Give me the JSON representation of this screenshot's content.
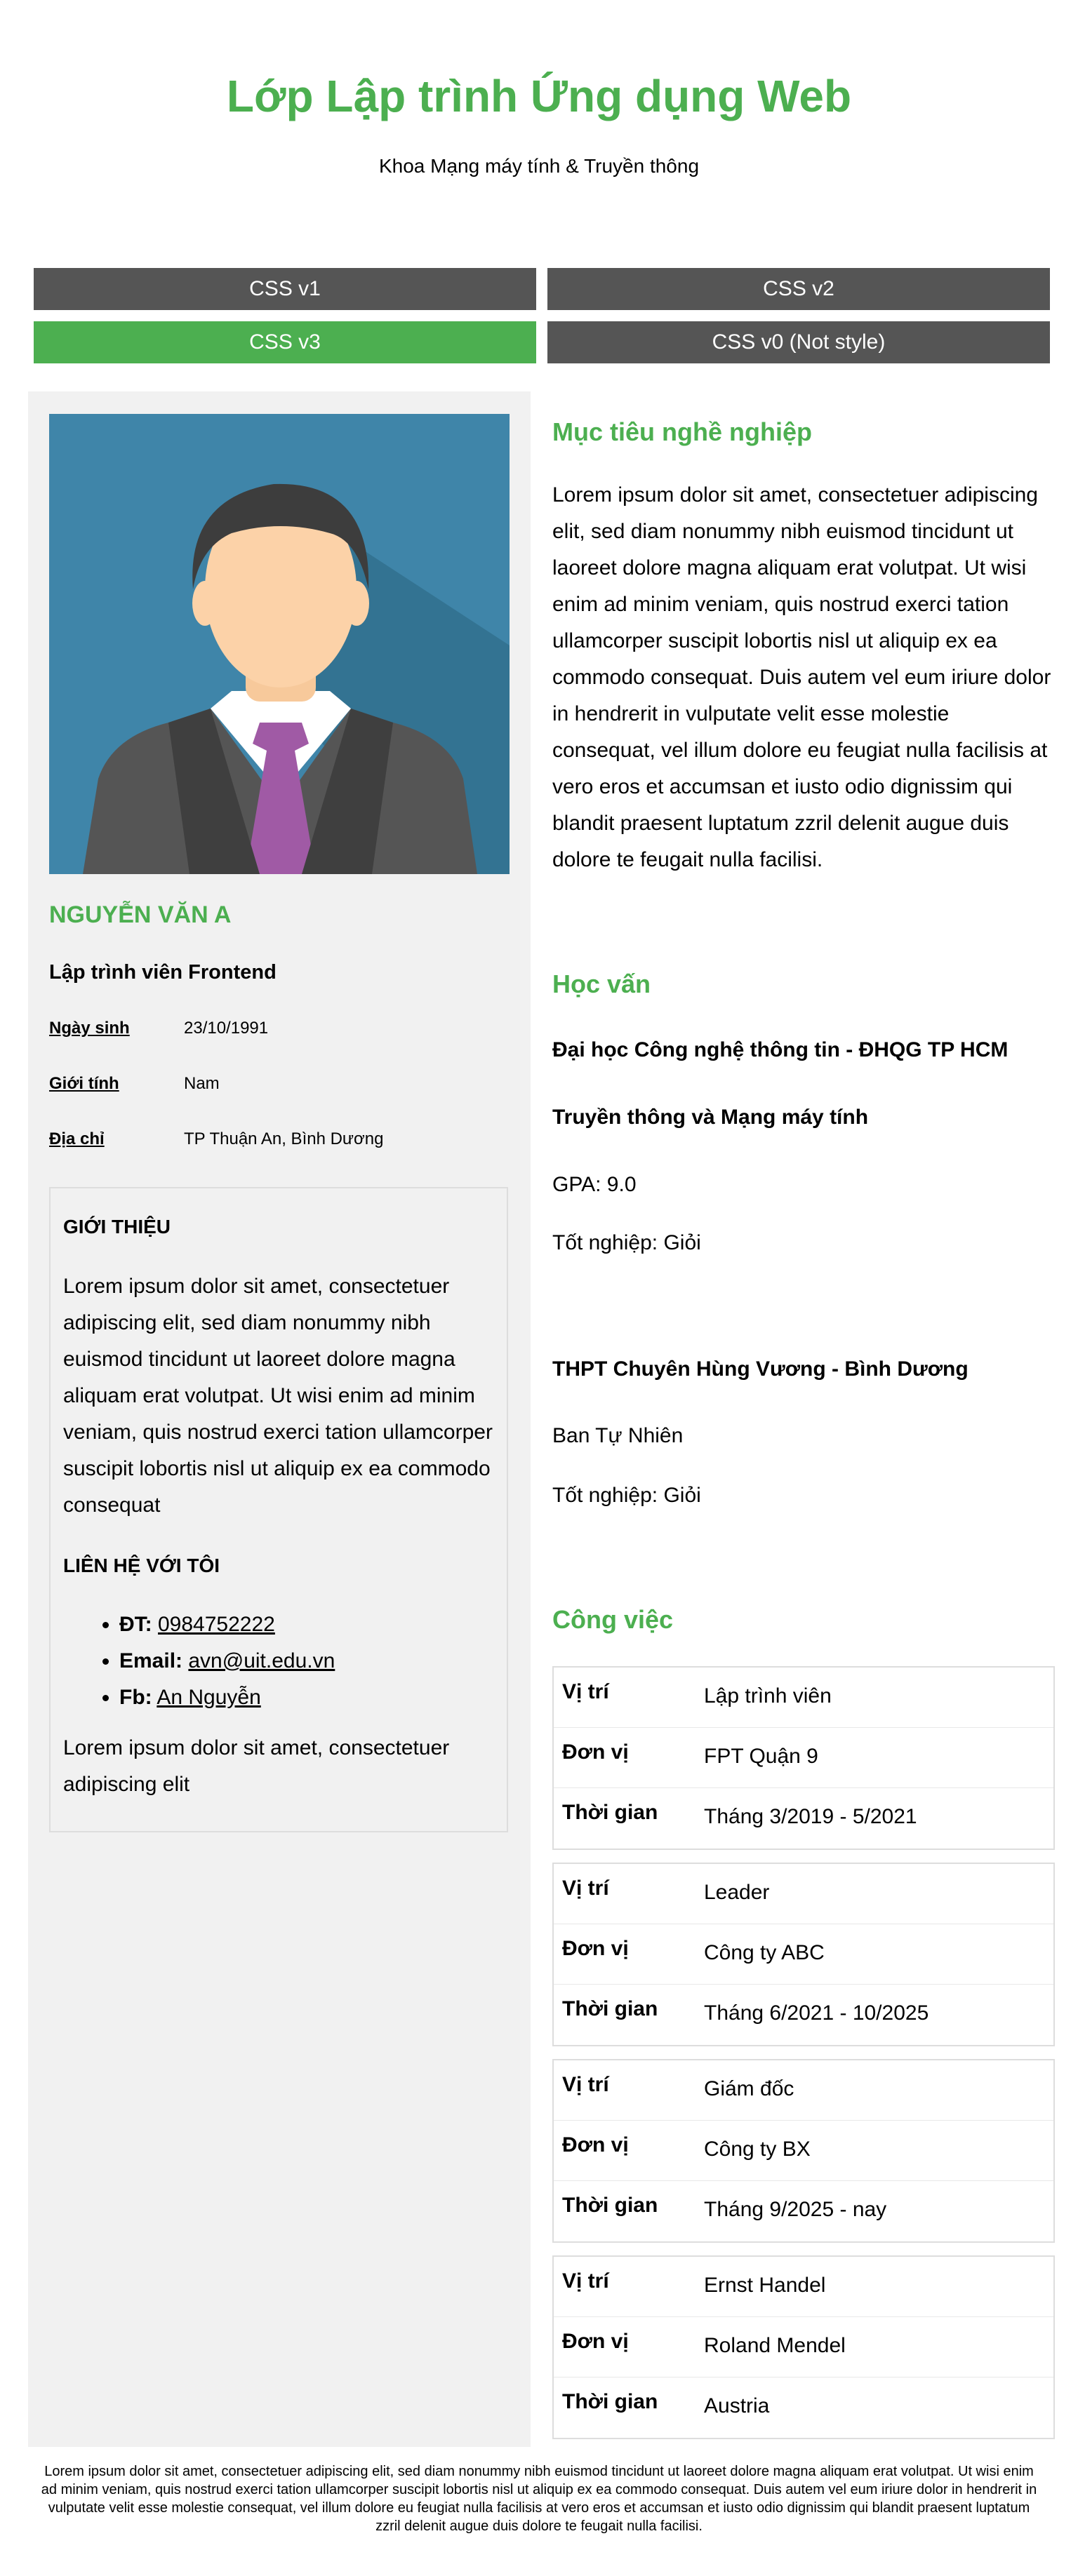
{
  "header": {
    "title": "Lớp Lập trình Ứng dụng Web",
    "subtitle": "Khoa Mạng máy tính & Truyền thông"
  },
  "nav": {
    "buttons": [
      {
        "label": "CSS v1",
        "active": false
      },
      {
        "label": "CSS v2",
        "active": false
      },
      {
        "label": "CSS v3",
        "active": true
      },
      {
        "label": "CSS v0 (Not style)",
        "active": false
      }
    ]
  },
  "profile": {
    "name": "NGUYỄN VĂN A",
    "role": "Lập trình viên Frontend",
    "info": [
      {
        "label": "Ngày sinh",
        "value": "23/10/1991"
      },
      {
        "label": "Giới tính",
        "value": "Nam"
      },
      {
        "label": "Địa chỉ",
        "value": "TP Thuận An, Bình Dương"
      }
    ],
    "intro_heading": "GIỚI THIỆU",
    "intro_text": "Lorem ipsum dolor sit amet, consectetuer adipiscing elit, sed diam nonummy nibh euismod tincidunt ut laoreet dolore magna aliquam erat volutpat. Ut wisi enim ad minim veniam, quis nostrud exerci tation ullamcorper suscipit lobortis nisl ut aliquip ex ea commodo consequat",
    "contact_heading": "LIÊN HỆ VỚI TÔI",
    "contacts": [
      {
        "label": "ĐT:",
        "value": "0984752222"
      },
      {
        "label": "Email:",
        "value": "avn@uit.edu.vn"
      },
      {
        "label": "Fb:",
        "value": "An Nguyễn"
      }
    ],
    "contact_note": "Lorem ipsum dolor sit amet, consectetuer adipiscing elit"
  },
  "career": {
    "title": "Mục tiêu nghề nghiệp",
    "text": "Lorem ipsum dolor sit amet, consectetuer adipiscing elit, sed diam nonummy nibh euismod tincidunt ut laoreet dolore magna aliquam erat volutpat. Ut wisi enim ad minim veniam, quis nostrud exerci tation ullamcorper suscipit lobortis nisl ut aliquip ex ea commodo consequat. Duis autem vel eum iriure dolor in hendrerit in vulputate velit esse molestie consequat, vel illum dolore eu feugiat nulla facilisis at vero eros et accumsan et iusto odio dignissim qui blandit praesent luptatum zzril delenit augue duis dolore te feugait nulla facilisi."
  },
  "education": {
    "title": "Học vấn",
    "university": "Đại học Công nghệ thông tin - ĐHQG TP HCM",
    "major": "Truyền thông và Mạng máy tính",
    "gpa": "GPA: 9.0",
    "uni_grad": "Tốt nghiệp: Giỏi",
    "school": "THPT Chuyên Hùng Vương - Bình Dương",
    "track": "Ban Tự Nhiên",
    "school_grad": "Tốt nghiệp: Giỏi"
  },
  "work": {
    "title": "Công việc",
    "labels": {
      "position": "Vị trí",
      "unit": "Đơn vị",
      "time": "Thời gian"
    },
    "jobs": [
      {
        "position": "Lập trình viên",
        "unit": "FPT Quận 9",
        "time": "Tháng 3/2019 - 5/2021"
      },
      {
        "position": "Leader",
        "unit": "Công ty ABC",
        "time": "Tháng 6/2021 - 10/2025"
      },
      {
        "position": "Giám đốc",
        "unit": "Công ty BX",
        "time": "Tháng 9/2025 - nay"
      },
      {
        "position": "Ernst Handel",
        "unit": "Roland Mendel",
        "time": "Austria"
      }
    ]
  },
  "footer": {
    "text": "Lorem ipsum dolor sit amet, consectetuer adipiscing elit, sed diam nonummy nibh euismod tincidunt ut laoreet dolore magna aliquam erat volutpat. Ut wisi enim ad minim veniam, quis nostrud exerci tation ullamcorper suscipit lobortis nisl ut aliquip ex ea commodo consequat. Duis autem vel eum iriure dolor in hendrerit in vulputate velit esse molestie consequat, vel illum dolore eu feugiat nulla facilisis at vero eros et accumsan et iusto odio dignissim qui blandit praesent luptatum zzril delenit augue duis dolore te feugait nulla facilisi."
  },
  "colors": {
    "accent": "#4caf50",
    "nav_default": "#555555",
    "sidebar_bg": "#f1f1f1"
  }
}
